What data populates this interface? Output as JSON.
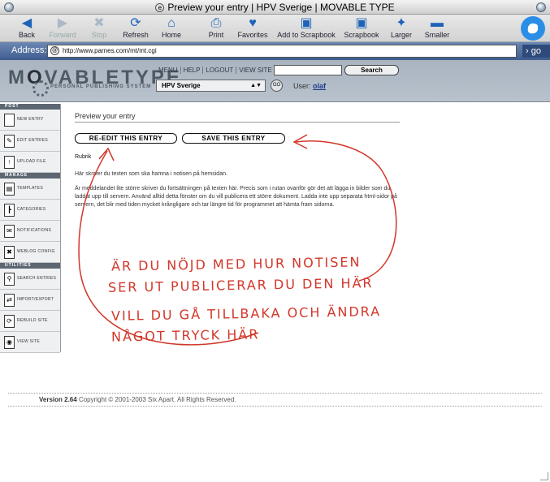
{
  "window": {
    "title": "Preview your entry | HPV Sverige | MOVABLE TYPE"
  },
  "toolbar": {
    "back": "Back",
    "forward": "Forward",
    "stop": "Stop",
    "refresh": "Refresh",
    "home": "Home",
    "print": "Print",
    "favorites": "Favorites",
    "add_scrapbook": "Add to Scrapbook",
    "scrapbook": "Scrapbook",
    "larger": "Larger",
    "smaller": "Smaller"
  },
  "address": {
    "label": "Address:",
    "url": "http://www.parnes.com/mt/mt.cgi",
    "go": "go"
  },
  "mt": {
    "logo_pre": "M",
    "logo_o": "O",
    "logo_post": "VABLETYPE",
    "tagline": "PERSONAL PUBLISHING SYSTEM",
    "nav": [
      "MENU",
      "HELP",
      "LOGOUT",
      "VIEW SITE"
    ],
    "search_button": "Search",
    "blog": "HPV Sverige",
    "go_circle": "GO",
    "user_label": "User:",
    "user_name": "olaf"
  },
  "sidebar": {
    "post_head": "POST",
    "manage_head": "MANAGE",
    "utilities_head": "UTILITIES",
    "items": [
      "NEW ENTRY",
      "EDIT ENTRIES",
      "UPLOAD FILE",
      "TEMPLATES",
      "CATEGORIES",
      "NOTIFICATIONS",
      "WEBLOG CONFIG",
      "SEARCH ENTRIES",
      "IMPORT/EXPORT",
      "REBUILD SITE",
      "VIEW SITE"
    ]
  },
  "content": {
    "title": "Preview your entry",
    "reedit": "RE-EDIT THIS ENTRY",
    "save": "SAVE THIS ENTRY",
    "rubrik": "Rubrik",
    "para1": "Här skriver du texten som ska hamna i notisen på hemsidan.",
    "para2": "Är meddelandet lite större skriver du fortsättningen på texten här. Precis som i rutan ovanför gör det att lägga in bilder som du laddat upp till servern. Använd alltid detta fönster om du vill publicera ett större dokument. Ladda inte upp separata html-sidor på servern, det blir med tiden mycket krångligare och tar längre tid för programmet att hämta fram sidorna."
  },
  "annotation": {
    "line1": "ÄR DU NÖJD MED HUR NOTISEN",
    "line2": "SER UT PUBLICERAR DU DEN HÄR",
    "line3": "VILL DU GÅ TILLBAKA OCH ÄNDRA",
    "line4": "NÅGOT TRYCK HÄR"
  },
  "footer": {
    "version": "Version 2.64",
    "copyright": "Copyright © 2001-2003 Six Apart. All Rights Reserved."
  },
  "colors": {
    "chrome_blue": "#3d5c8e",
    "mt_header": "#b8c2cd",
    "annotation_red": "#d2372a"
  }
}
